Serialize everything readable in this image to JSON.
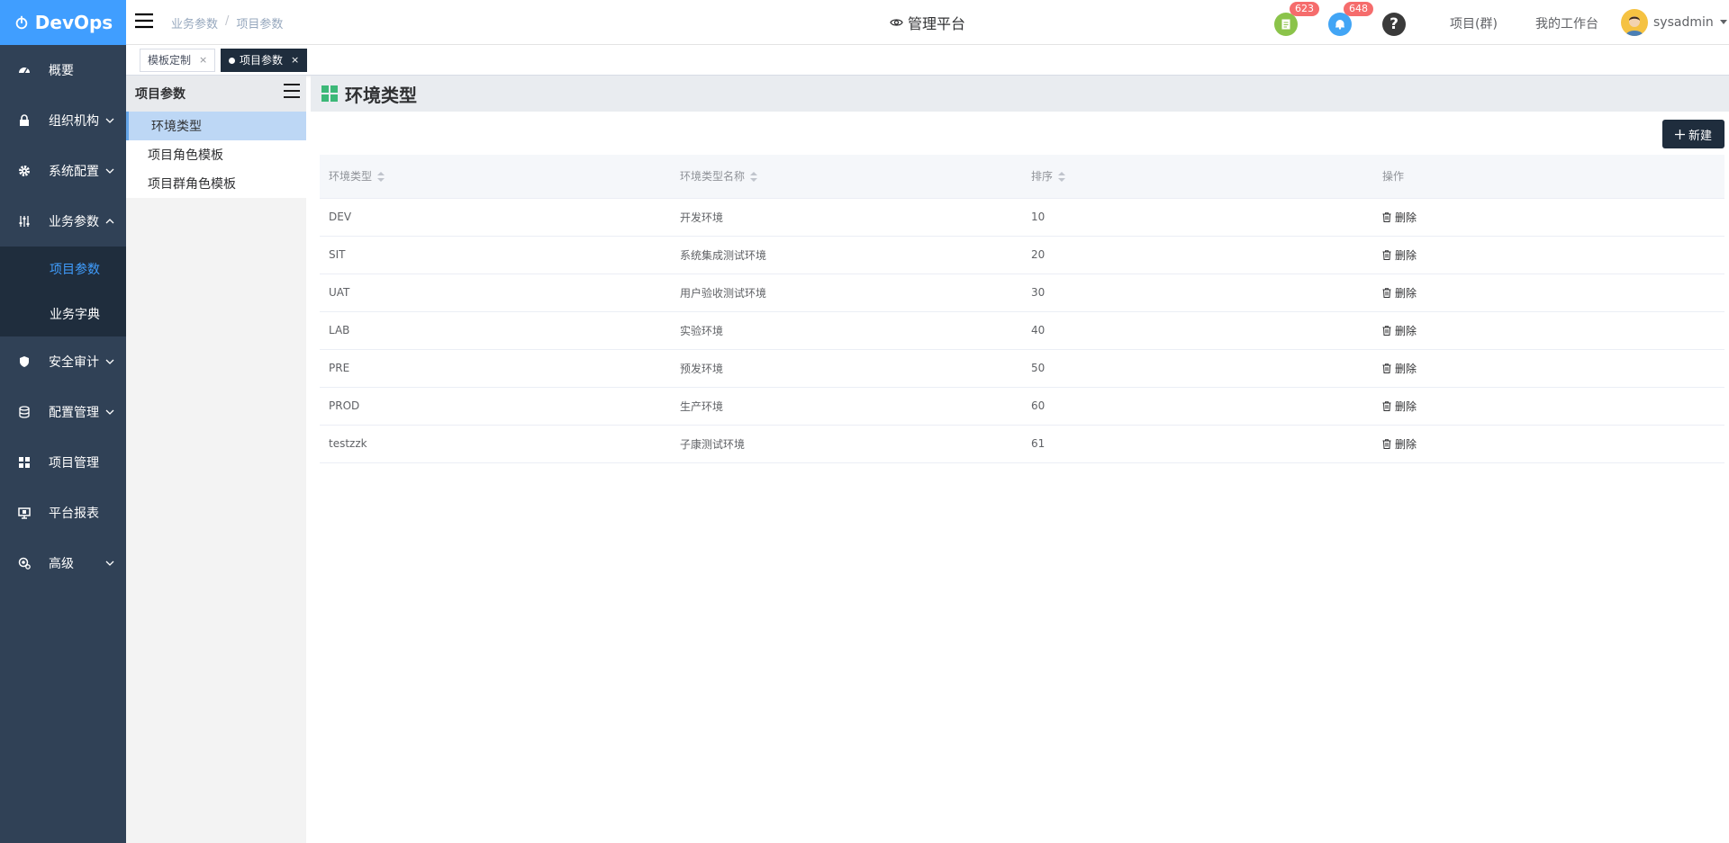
{
  "app": {
    "logo_text": "DevOps"
  },
  "sidebar": {
    "items": [
      {
        "label": "概要",
        "icon": "dashboard-icon"
      },
      {
        "label": "组织机构",
        "icon": "lock-icon"
      },
      {
        "label": "系统配置",
        "icon": "gear-icon"
      },
      {
        "label": "业务参数",
        "icon": "sliders-icon"
      },
      {
        "label": "安全审计",
        "icon": "shield-icon"
      },
      {
        "label": "配置管理",
        "icon": "database-icon"
      },
      {
        "label": "项目管理",
        "icon": "grid-icon"
      },
      {
        "label": "平台报表",
        "icon": "monitor-icon"
      },
      {
        "label": "高级",
        "icon": "advanced-icon"
      }
    ],
    "submenu": [
      {
        "label": "项目参数"
      },
      {
        "label": "业务字典"
      }
    ]
  },
  "header": {
    "breadcrumb": [
      "业务参数",
      "/",
      "项目参数"
    ],
    "platform_label": "管理平台",
    "doc_badge": "623",
    "bell_badge": "648",
    "help_label": "?",
    "project_group": "项目(群)",
    "workbench": "我的工作台",
    "username": "sysadmin"
  },
  "tags": {
    "items": [
      {
        "label": "模板定制",
        "close": "×"
      },
      {
        "label": "项目参数",
        "close": "×"
      }
    ]
  },
  "left_panel": {
    "title": "项目参数",
    "items": [
      "环境类型",
      "项目角色模板",
      "项目群角色模板"
    ]
  },
  "main": {
    "title": "环境类型",
    "new_button": "新建",
    "columns": [
      "环境类型",
      "环境类型名称",
      "排序",
      "操作"
    ],
    "delete_label": "删除",
    "rows": [
      {
        "code": "DEV",
        "name": "开发环境",
        "order": "10"
      },
      {
        "code": "SIT",
        "name": "系统集成测试环境",
        "order": "20"
      },
      {
        "code": "UAT",
        "name": "用户验收测试环境",
        "order": "30"
      },
      {
        "code": "LAB",
        "name": "实验环境",
        "order": "40"
      },
      {
        "code": "PRE",
        "name": "预发环境",
        "order": "50"
      },
      {
        "code": "PROD",
        "name": "生产环境",
        "order": "60"
      },
      {
        "code": "testzzk",
        "name": "子康测试环境",
        "order": "61"
      }
    ]
  },
  "colors": {
    "sidebar_bg": "#304156",
    "submenu_bg": "#1f2d3d",
    "logo_bg": "#409eff",
    "active_sub": "#409eff",
    "badge": "#f56c6c",
    "doc_icon_bg": "#8bc34a",
    "bell_icon_bg": "#42a5f5"
  }
}
